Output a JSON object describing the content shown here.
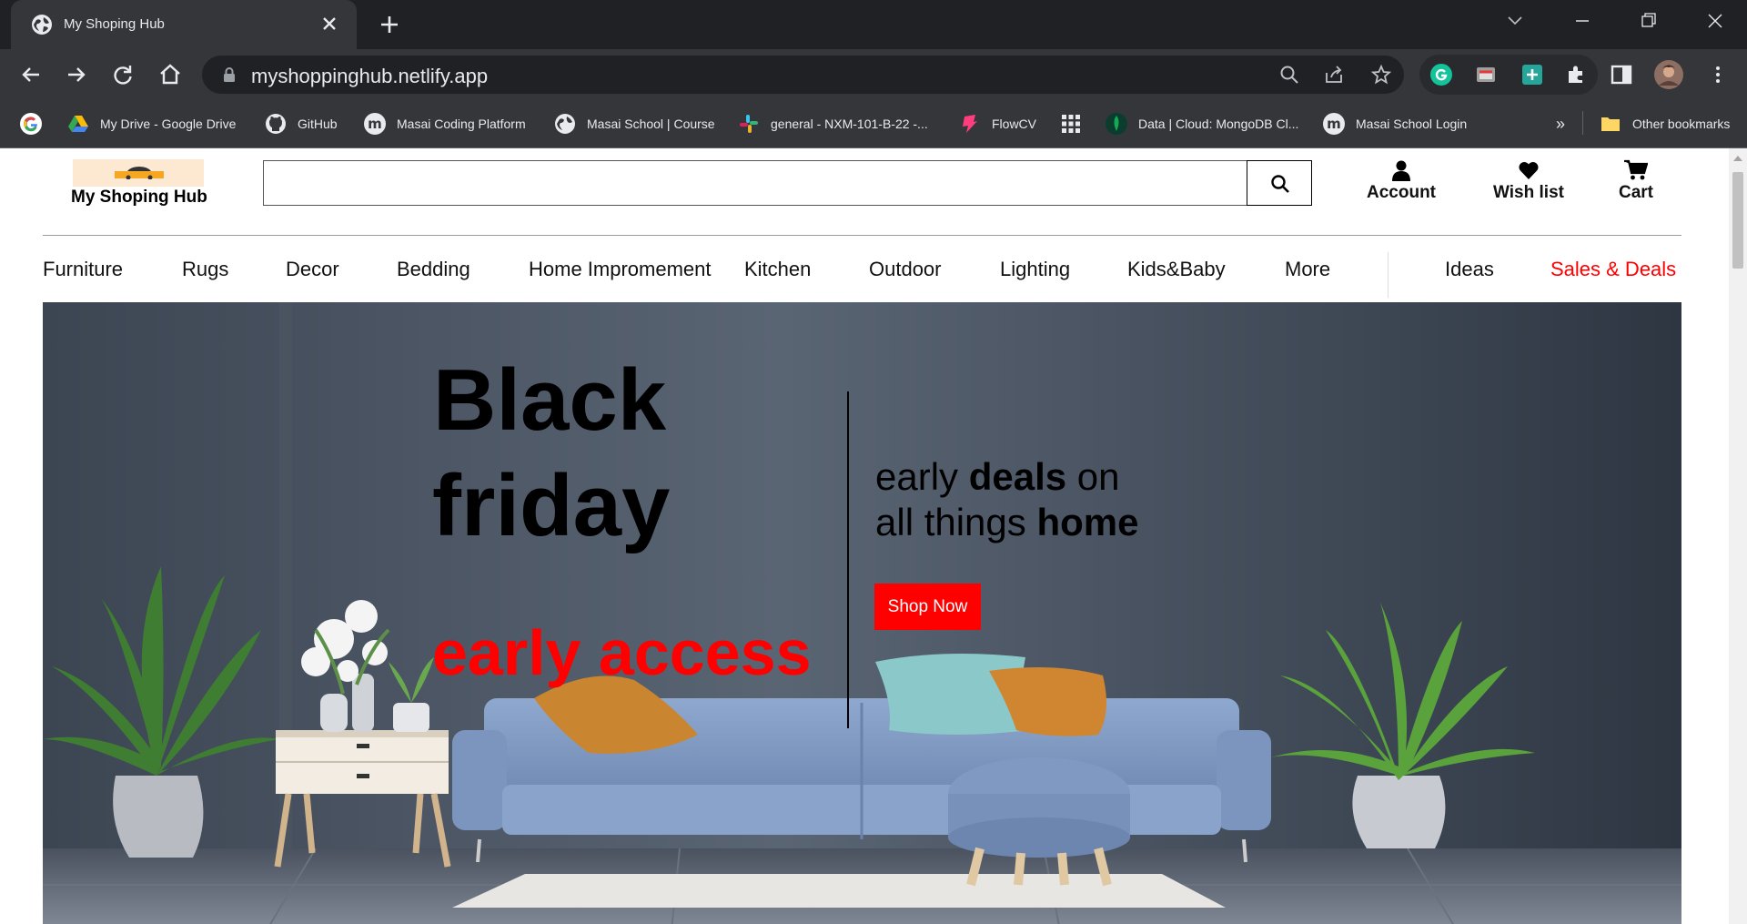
{
  "browser": {
    "tab_title": "My Shoping Hub",
    "url": "myshoppinghub.netlify.app",
    "bookmarks": [
      {
        "label": "My Drive - Google Drive",
        "icon": "google-drive-icon"
      },
      {
        "label": "GitHub",
        "icon": "github-icon"
      },
      {
        "label": "Masai Coding Platform",
        "icon": "masai-icon"
      },
      {
        "label": "Masai School | Course",
        "icon": "globe-icon"
      },
      {
        "label": "general - NXM-101-B-22 -...",
        "icon": "slack-icon"
      },
      {
        "label": "FlowCV",
        "icon": "flowcv-icon"
      },
      {
        "label": "Data | Cloud: MongoDB Cl...",
        "icon": "mongodb-icon"
      },
      {
        "label": "Masai School Login",
        "icon": "masai-icon"
      }
    ],
    "overflow_label": "»",
    "other_bookmarks": "Other bookmarks"
  },
  "site": {
    "brand": "My Shoping Hub",
    "search": {
      "value": "",
      "placeholder": ""
    },
    "header_links": [
      {
        "label": "Account",
        "icon": "user-icon"
      },
      {
        "label": "Wish list",
        "icon": "heart-icon"
      },
      {
        "label": "Cart",
        "icon": "cart-icon"
      }
    ],
    "nav": [
      "Furniture",
      "Rugs",
      "Decor",
      "Bedding",
      "Home Impromement",
      "Kitchen",
      "Outdoor",
      "Lighting",
      "Kids&Baby",
      "More",
      "Ideas",
      "Sales & Deals"
    ],
    "hero": {
      "line1": "Black",
      "line2": "friday",
      "early_access": "early access",
      "sub_line1_a": "early ",
      "sub_line1_b": "deals",
      "sub_line1_c": " on",
      "sub_line2_a": "all things ",
      "sub_line2_b": "home",
      "cta": "Shop Now"
    }
  },
  "colors": {
    "accent_red": "#ff0000",
    "chrome_dark": "#202124",
    "chrome_toolbar": "#35363a"
  }
}
